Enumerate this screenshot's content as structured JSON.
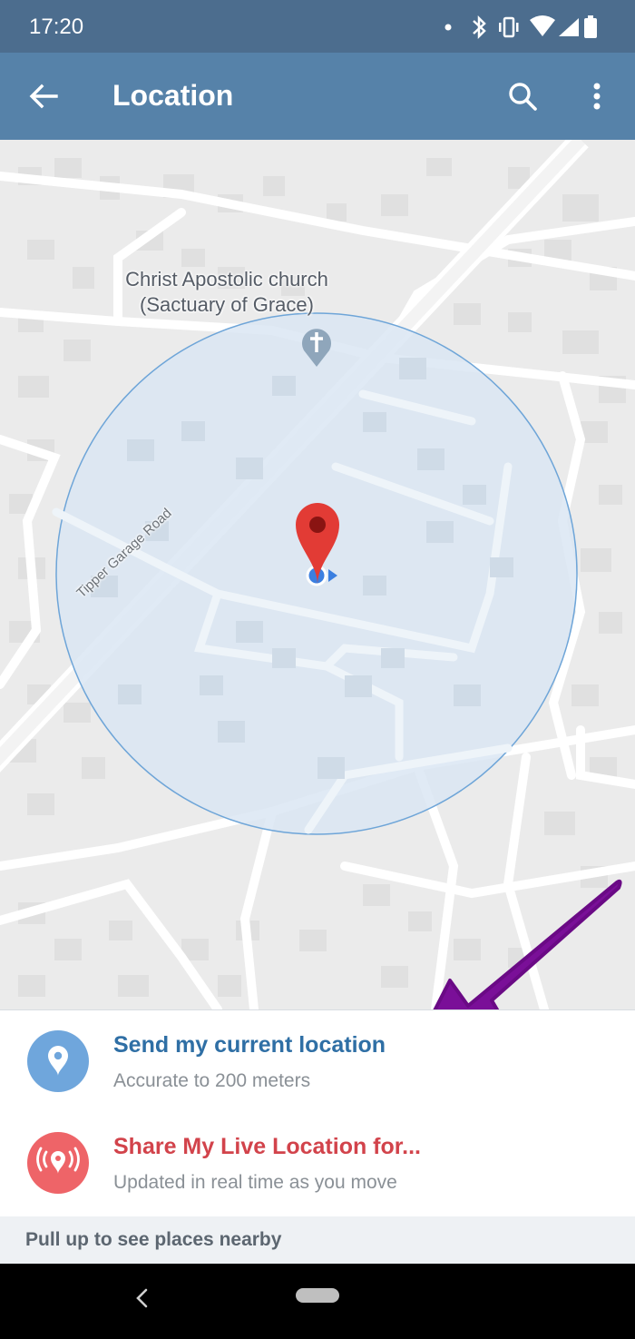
{
  "status_bar": {
    "time": "17:20",
    "icons": [
      "dot-icon",
      "bluetooth-icon",
      "vibrate-icon",
      "wifi-icon",
      "signal-icon",
      "battery-icon"
    ]
  },
  "app_bar": {
    "title": "Location",
    "back_icon": "arrow-left-icon",
    "search_icon": "search-icon",
    "more_icon": "more-vert-icon"
  },
  "map": {
    "church_label_line1": "Christ Apostolic church",
    "church_label_line2": "(Sactuary of Grace)",
    "road_label": "Tipper Garage Road",
    "accuracy_color": "#dbe7f3",
    "pin_color": "#e23b35"
  },
  "options": {
    "send": {
      "label": "Send my current location",
      "sub": "Accurate to 200 meters",
      "color": "#2f6fa5",
      "icon_bg": "#6fa6dc",
      "icon": "location-pin-icon"
    },
    "live": {
      "label": "Share My Live Location for...",
      "sub": "Updated in real time as you move",
      "color": "#d2434b",
      "icon_bg": "#ee6468",
      "icon": "live-location-icon"
    }
  },
  "nearby": {
    "text": "Pull up to see places nearby"
  },
  "annotation": {
    "arrow_color": "#7a0f98"
  }
}
